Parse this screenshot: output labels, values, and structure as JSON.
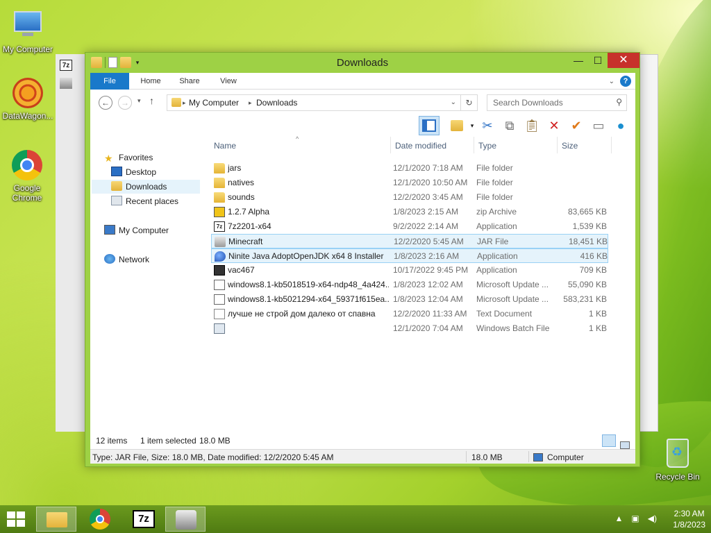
{
  "desktop": {
    "icons": [
      {
        "label": "My Computer"
      },
      {
        "label": "DataWagon..."
      },
      {
        "label": "Google Chrome"
      },
      {
        "label": "Recycle Bin"
      }
    ]
  },
  "window": {
    "title": "Downloads",
    "caption": {
      "minimize": "—",
      "maximize": "☐",
      "close": "✕"
    }
  },
  "ribbon": {
    "tabs": [
      "File",
      "Home",
      "Share",
      "View"
    ]
  },
  "address": {
    "crumbs": [
      "My Computer",
      "Downloads"
    ],
    "search_placeholder": "Search Downloads"
  },
  "nav": {
    "favorites": "Favorites",
    "desktop": "Desktop",
    "downloads": "Downloads",
    "recent": "Recent places",
    "computer": "My Computer",
    "network": "Network"
  },
  "columns": {
    "name": "Name",
    "date": "Date modified",
    "type": "Type",
    "size": "Size"
  },
  "files": [
    {
      "name": "jars",
      "date": "12/1/2020 7:18 AM",
      "type": "File folder",
      "size": "",
      "icon": "folder"
    },
    {
      "name": "natives",
      "date": "12/1/2020 10:50 AM",
      "type": "File folder",
      "size": "",
      "icon": "folder"
    },
    {
      "name": "sounds",
      "date": "12/2/2020 3:45 AM",
      "type": "File folder",
      "size": "",
      "icon": "folder"
    },
    {
      "name": "1.2.7 Alpha",
      "date": "1/8/2023 2:15 AM",
      "type": "zip Archive",
      "size": "83,665 KB",
      "icon": "zip"
    },
    {
      "name": "7z2201-x64",
      "date": "9/2/2022 2:14 AM",
      "type": "Application",
      "size": "1,539 KB",
      "icon": "7z"
    },
    {
      "name": "Minecraft",
      "date": "12/2/2020 5:45 AM",
      "type": "JAR File",
      "size": "18,451 KB",
      "icon": "jar"
    },
    {
      "name": "Ninite Java AdoptOpenJDK x64 8 Installer",
      "date": "1/8/2023 2:16 AM",
      "type": "Application",
      "size": "416 KB",
      "icon": "ninite"
    },
    {
      "name": "vac467",
      "date": "10/17/2022 9:45 PM",
      "type": "Application",
      "size": "709 KB",
      "icon": "vac"
    },
    {
      "name": "windows8.1-kb5018519-x64-ndp48_4a424...",
      "date": "1/8/2023 12:02 AM",
      "type": "Microsoft Update ...",
      "size": "55,090 KB",
      "icon": "msu"
    },
    {
      "name": "windows8.1-kb5021294-x64_59371f615ea...",
      "date": "1/8/2023 12:04 AM",
      "type": "Microsoft Update ...",
      "size": "583,231 KB",
      "icon": "msu"
    },
    {
      "name": "лучше не строй дом далеко от спавна",
      "date": "12/2/2020 11:33 AM",
      "type": "Text Document",
      "size": "1 KB",
      "icon": "txt"
    },
    {
      "name": "",
      "date": "12/1/2020 7:04 AM",
      "type": "Windows Batch File",
      "size": "1 KB",
      "icon": "bat"
    }
  ],
  "status": {
    "items": "12 items",
    "selected": "1 item selected",
    "selected_size": "18.0 MB",
    "details": "Type: JAR File, Size: 18.0 MB, Date modified: 12/2/2020 5:45 AM",
    "size": "18.0 MB",
    "location": "Computer"
  },
  "taskbar": {
    "time": "2:30 AM",
    "date": "1/8/2023"
  },
  "ghost": {
    "label_7z": "7z"
  },
  "colors": {
    "accent": "#1979ca",
    "window_frame": "#9ed145",
    "selection": "#e5f3fb"
  }
}
